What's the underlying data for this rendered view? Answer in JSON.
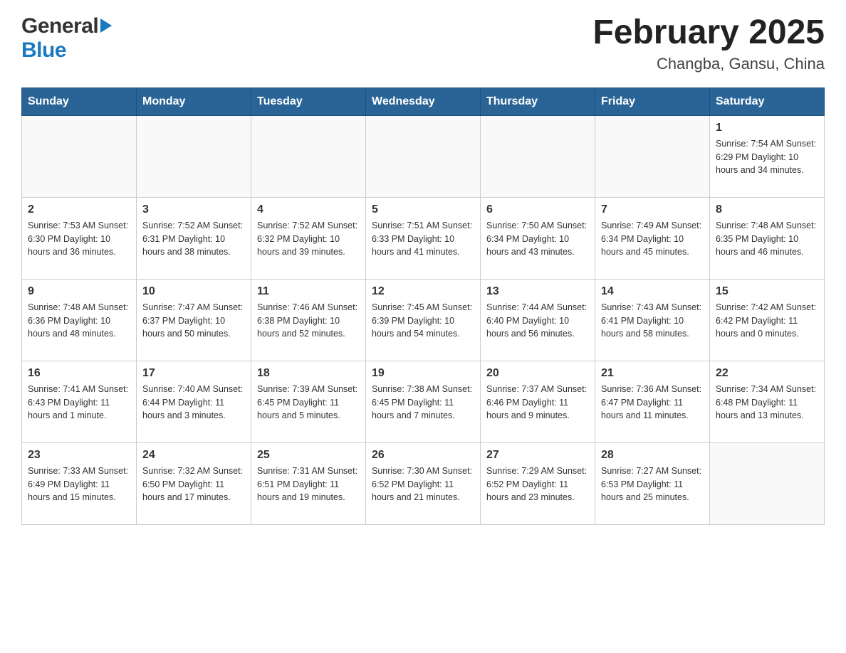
{
  "header": {
    "logo_general": "General",
    "logo_blue": "Blue",
    "title": "February 2025",
    "location": "Changba, Gansu, China"
  },
  "days_of_week": [
    "Sunday",
    "Monday",
    "Tuesday",
    "Wednesday",
    "Thursday",
    "Friday",
    "Saturday"
  ],
  "weeks": [
    {
      "days": [
        {
          "date": "",
          "info": ""
        },
        {
          "date": "",
          "info": ""
        },
        {
          "date": "",
          "info": ""
        },
        {
          "date": "",
          "info": ""
        },
        {
          "date": "",
          "info": ""
        },
        {
          "date": "",
          "info": ""
        },
        {
          "date": "1",
          "info": "Sunrise: 7:54 AM\nSunset: 6:29 PM\nDaylight: 10 hours and 34 minutes."
        }
      ]
    },
    {
      "days": [
        {
          "date": "2",
          "info": "Sunrise: 7:53 AM\nSunset: 6:30 PM\nDaylight: 10 hours and 36 minutes."
        },
        {
          "date": "3",
          "info": "Sunrise: 7:52 AM\nSunset: 6:31 PM\nDaylight: 10 hours and 38 minutes."
        },
        {
          "date": "4",
          "info": "Sunrise: 7:52 AM\nSunset: 6:32 PM\nDaylight: 10 hours and 39 minutes."
        },
        {
          "date": "5",
          "info": "Sunrise: 7:51 AM\nSunset: 6:33 PM\nDaylight: 10 hours and 41 minutes."
        },
        {
          "date": "6",
          "info": "Sunrise: 7:50 AM\nSunset: 6:34 PM\nDaylight: 10 hours and 43 minutes."
        },
        {
          "date": "7",
          "info": "Sunrise: 7:49 AM\nSunset: 6:34 PM\nDaylight: 10 hours and 45 minutes."
        },
        {
          "date": "8",
          "info": "Sunrise: 7:48 AM\nSunset: 6:35 PM\nDaylight: 10 hours and 46 minutes."
        }
      ]
    },
    {
      "days": [
        {
          "date": "9",
          "info": "Sunrise: 7:48 AM\nSunset: 6:36 PM\nDaylight: 10 hours and 48 minutes."
        },
        {
          "date": "10",
          "info": "Sunrise: 7:47 AM\nSunset: 6:37 PM\nDaylight: 10 hours and 50 minutes."
        },
        {
          "date": "11",
          "info": "Sunrise: 7:46 AM\nSunset: 6:38 PM\nDaylight: 10 hours and 52 minutes."
        },
        {
          "date": "12",
          "info": "Sunrise: 7:45 AM\nSunset: 6:39 PM\nDaylight: 10 hours and 54 minutes."
        },
        {
          "date": "13",
          "info": "Sunrise: 7:44 AM\nSunset: 6:40 PM\nDaylight: 10 hours and 56 minutes."
        },
        {
          "date": "14",
          "info": "Sunrise: 7:43 AM\nSunset: 6:41 PM\nDaylight: 10 hours and 58 minutes."
        },
        {
          "date": "15",
          "info": "Sunrise: 7:42 AM\nSunset: 6:42 PM\nDaylight: 11 hours and 0 minutes."
        }
      ]
    },
    {
      "days": [
        {
          "date": "16",
          "info": "Sunrise: 7:41 AM\nSunset: 6:43 PM\nDaylight: 11 hours and 1 minute."
        },
        {
          "date": "17",
          "info": "Sunrise: 7:40 AM\nSunset: 6:44 PM\nDaylight: 11 hours and 3 minutes."
        },
        {
          "date": "18",
          "info": "Sunrise: 7:39 AM\nSunset: 6:45 PM\nDaylight: 11 hours and 5 minutes."
        },
        {
          "date": "19",
          "info": "Sunrise: 7:38 AM\nSunset: 6:45 PM\nDaylight: 11 hours and 7 minutes."
        },
        {
          "date": "20",
          "info": "Sunrise: 7:37 AM\nSunset: 6:46 PM\nDaylight: 11 hours and 9 minutes."
        },
        {
          "date": "21",
          "info": "Sunrise: 7:36 AM\nSunset: 6:47 PM\nDaylight: 11 hours and 11 minutes."
        },
        {
          "date": "22",
          "info": "Sunrise: 7:34 AM\nSunset: 6:48 PM\nDaylight: 11 hours and 13 minutes."
        }
      ]
    },
    {
      "days": [
        {
          "date": "23",
          "info": "Sunrise: 7:33 AM\nSunset: 6:49 PM\nDaylight: 11 hours and 15 minutes."
        },
        {
          "date": "24",
          "info": "Sunrise: 7:32 AM\nSunset: 6:50 PM\nDaylight: 11 hours and 17 minutes."
        },
        {
          "date": "25",
          "info": "Sunrise: 7:31 AM\nSunset: 6:51 PM\nDaylight: 11 hours and 19 minutes."
        },
        {
          "date": "26",
          "info": "Sunrise: 7:30 AM\nSunset: 6:52 PM\nDaylight: 11 hours and 21 minutes."
        },
        {
          "date": "27",
          "info": "Sunrise: 7:29 AM\nSunset: 6:52 PM\nDaylight: 11 hours and 23 minutes."
        },
        {
          "date": "28",
          "info": "Sunrise: 7:27 AM\nSunset: 6:53 PM\nDaylight: 11 hours and 25 minutes."
        },
        {
          "date": "",
          "info": ""
        }
      ]
    }
  ]
}
